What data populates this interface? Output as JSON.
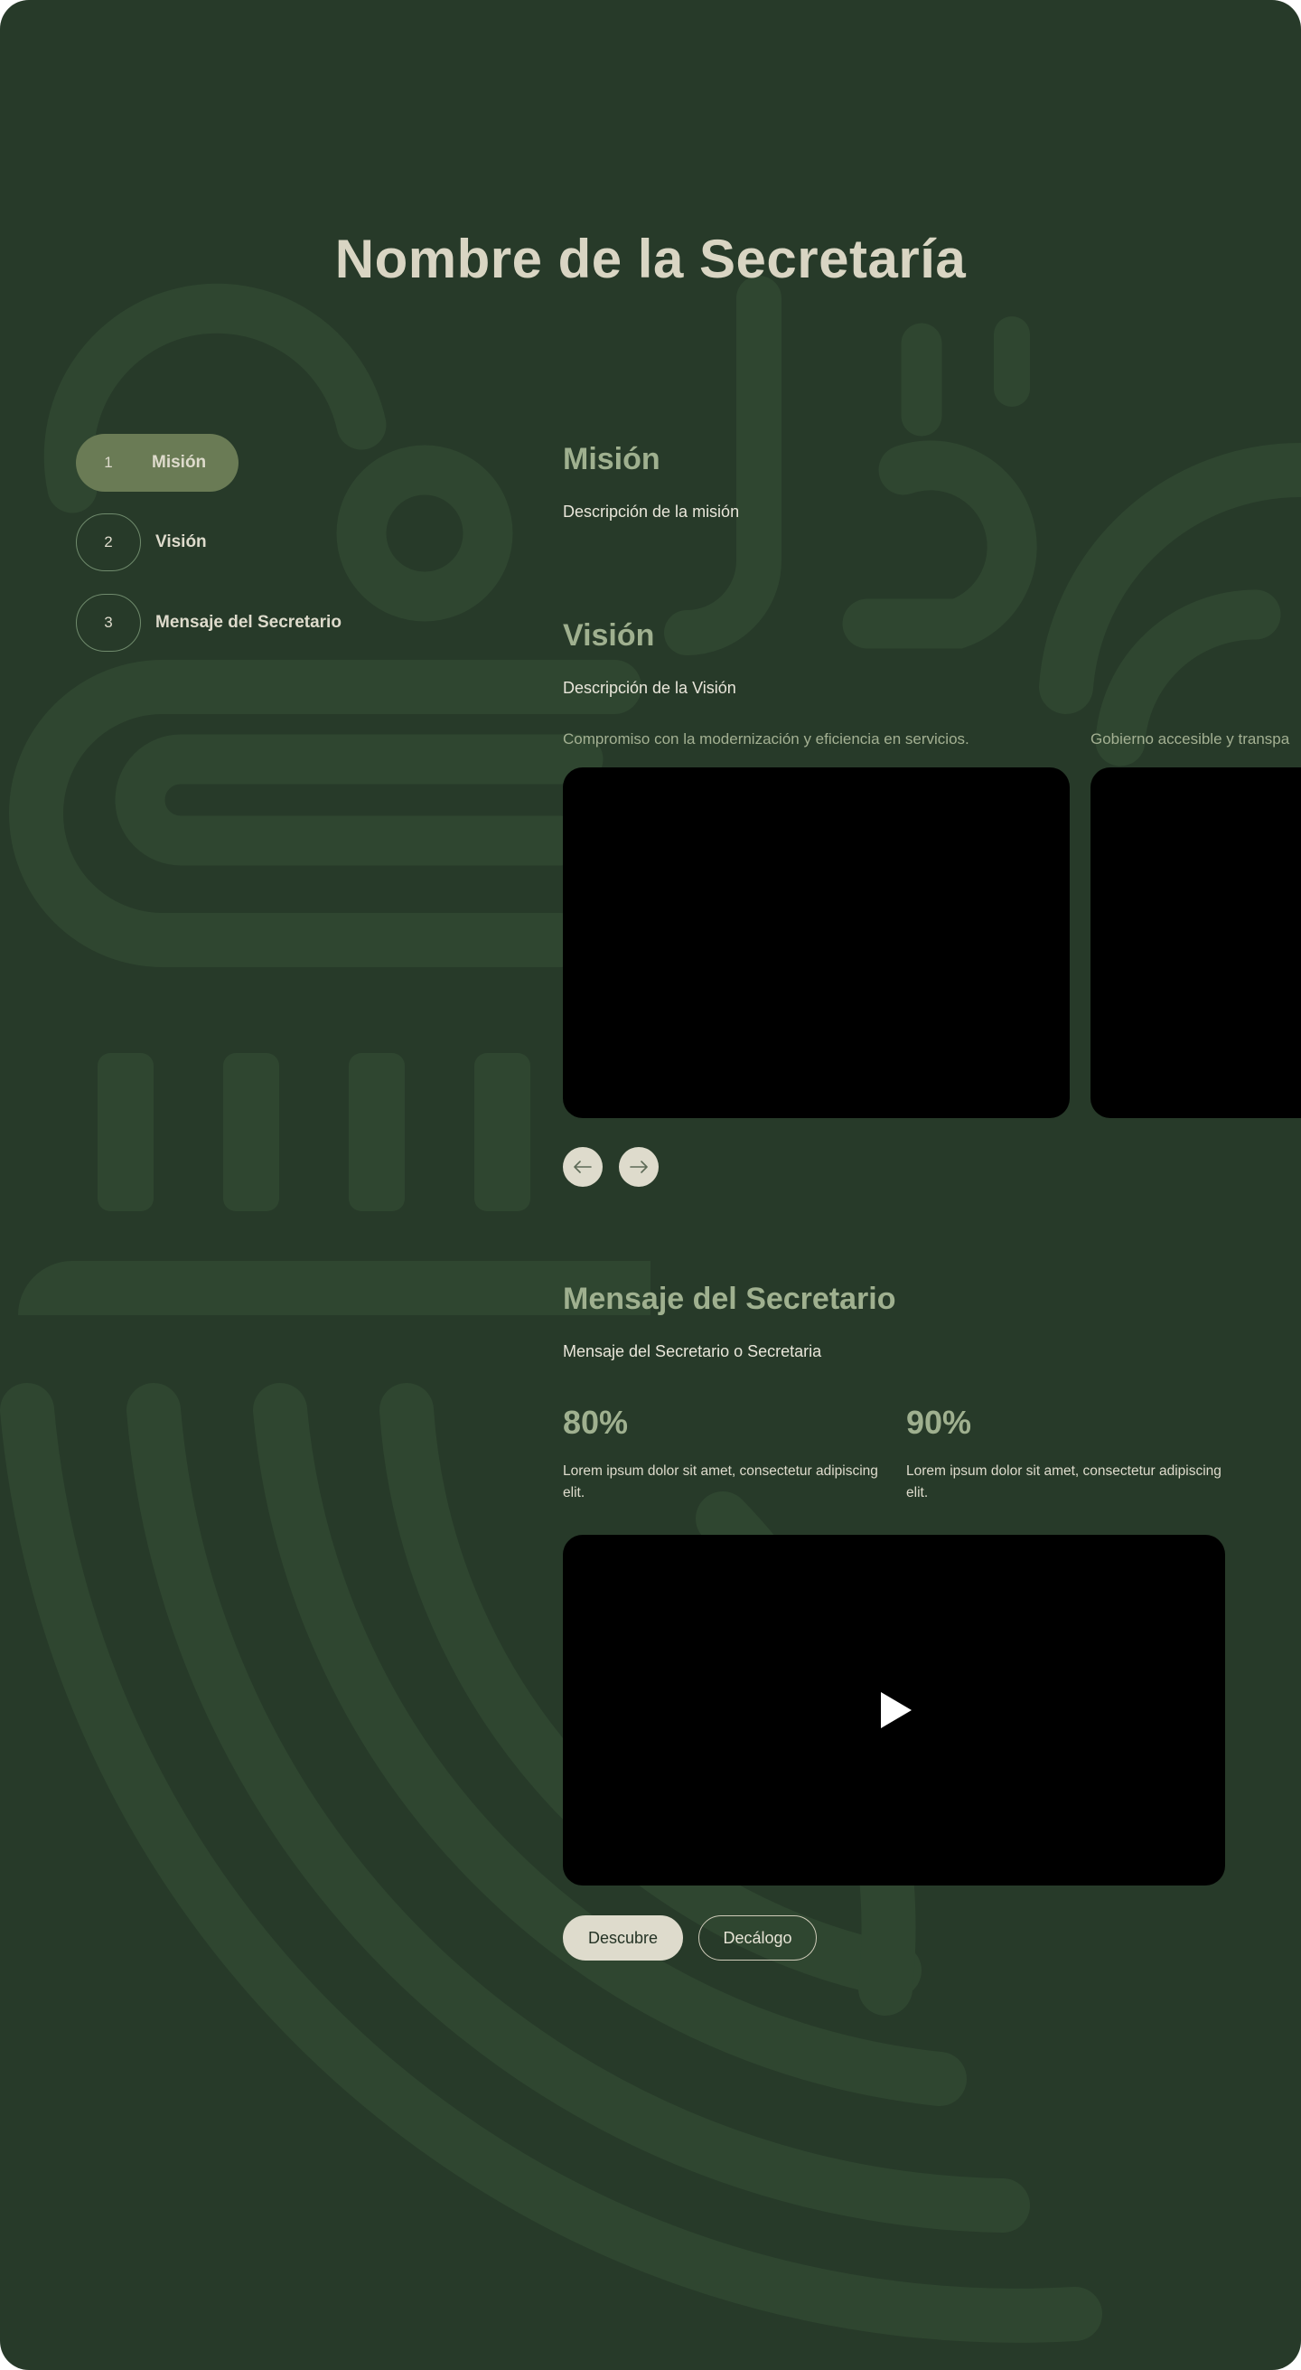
{
  "page": {
    "title": "Nombre de la Secretaría"
  },
  "steps": [
    {
      "number": "1",
      "label": "Misión",
      "active": true
    },
    {
      "number": "2",
      "label": "Visión",
      "active": false
    },
    {
      "number": "3",
      "label": "Mensaje del Secretario",
      "active": false
    }
  ],
  "mision": {
    "title": "Misión",
    "description": "Descripción de la misión"
  },
  "vision": {
    "title": "Visión",
    "description": "Descripción de la Visión",
    "slides": [
      {
        "caption": "Compromiso con la modernización y eficiencia en servicios."
      },
      {
        "caption": "Gobierno accesible y transpa"
      }
    ],
    "nav": {
      "prev_icon": "arrow-left-icon",
      "next_icon": "arrow-right-icon"
    }
  },
  "mensaje": {
    "title": "Mensaje del Secretario",
    "description": "Mensaje del Secretario o Secretaria",
    "stats": [
      {
        "value": "80%",
        "description": "Lorem ipsum dolor sit amet, consectetur adipiscing elit."
      },
      {
        "value": "90%",
        "description": "Lorem ipsum dolor sit amet, consectetur adipiscing elit."
      }
    ],
    "video": {
      "icon": "play-icon"
    },
    "buttons": {
      "primary": "Descubre",
      "secondary": "Decálogo"
    }
  },
  "colors": {
    "background": "#273a29",
    "accent": "#9fb08f",
    "cream": "#dedbcc",
    "active_step": "#6a7b55"
  }
}
